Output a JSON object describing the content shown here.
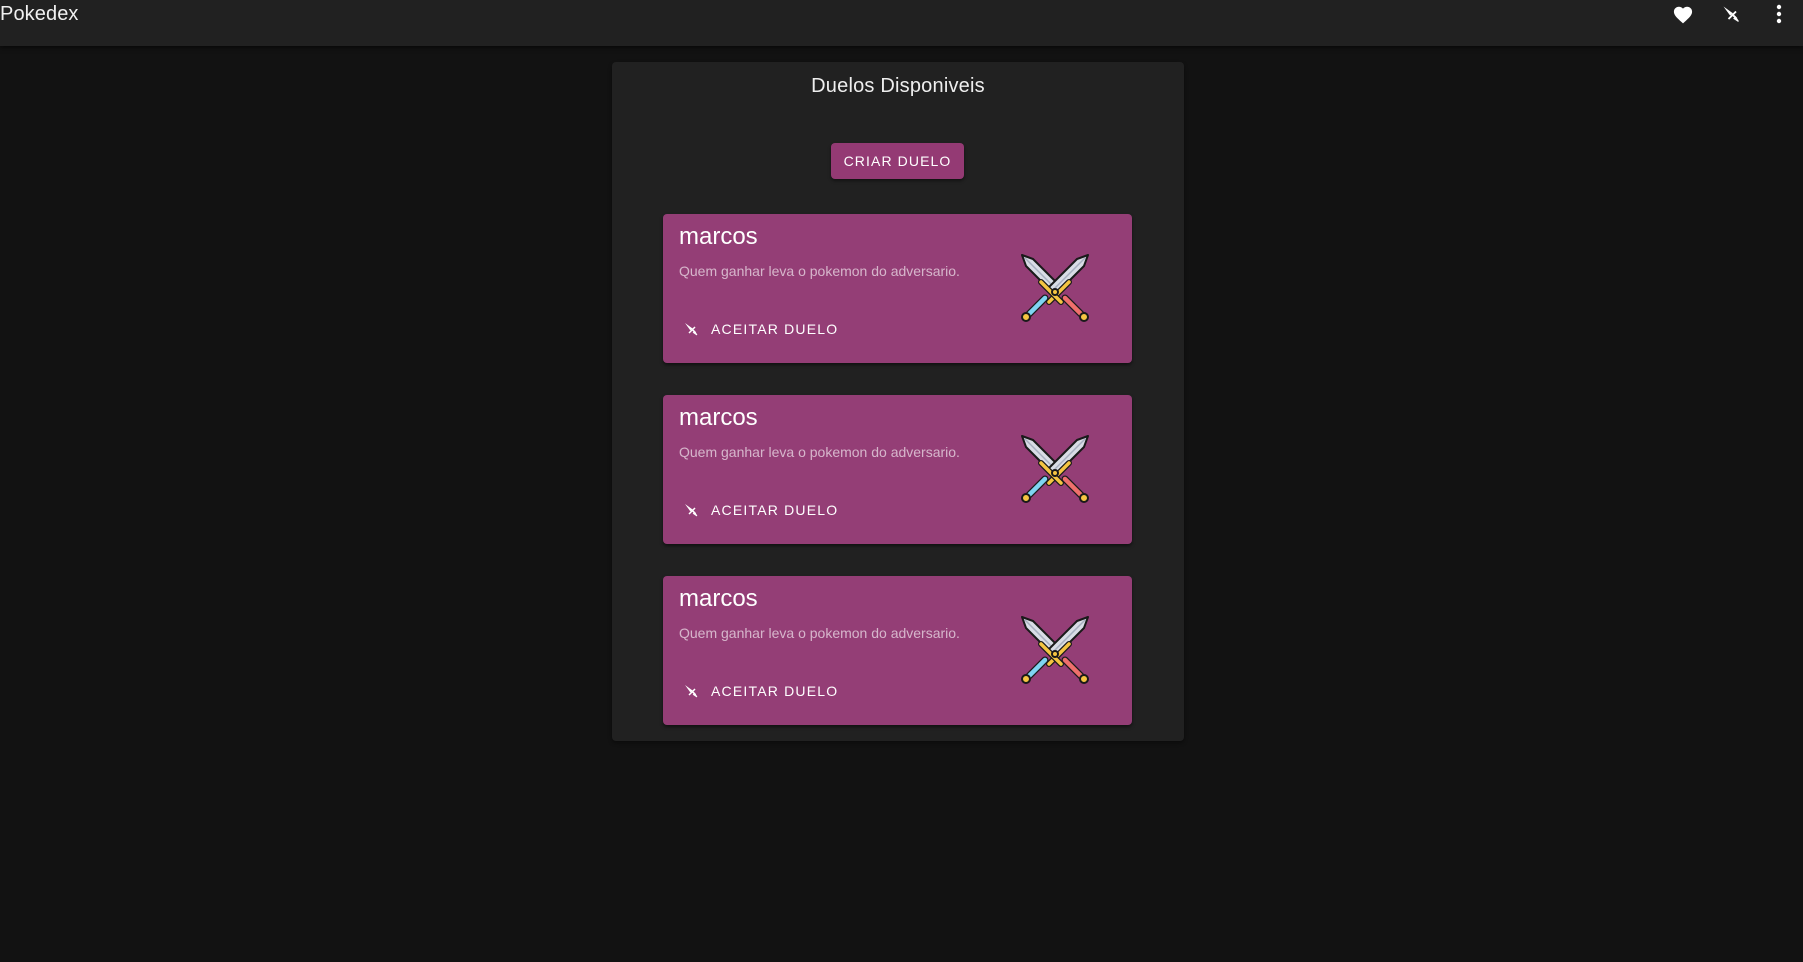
{
  "app": {
    "title": "Pokedex",
    "actions": [
      {
        "icon": "heart-icon"
      },
      {
        "icon": "sword-icon"
      },
      {
        "icon": "more-vertical-icon"
      }
    ]
  },
  "panel": {
    "title": "Duelos Disponiveis",
    "create_label": "CRIAR DUELO"
  },
  "duels": [
    {
      "name": "marcos",
      "description": "Quem ganhar leva o pokemon do adversario.",
      "accept_label": "ACEITAR DUELO",
      "icon": "crossed-swords-icon"
    },
    {
      "name": "marcos",
      "description": "Quem ganhar leva o pokemon do adversario.",
      "accept_label": "ACEITAR DUELO",
      "icon": "crossed-swords-icon"
    },
    {
      "name": "marcos",
      "description": "Quem ganhar leva o pokemon do adversario.",
      "accept_label": "ACEITAR DUELO",
      "icon": "crossed-swords-icon"
    }
  ],
  "colors": {
    "background": "#121212",
    "appbar": "#212121",
    "panel": "#212121",
    "accent": "#943e76"
  }
}
